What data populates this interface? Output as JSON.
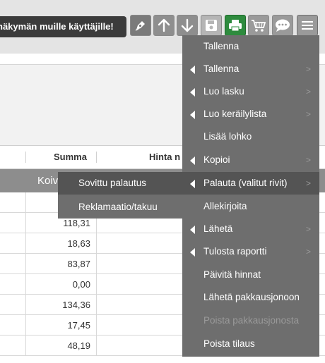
{
  "toolbar": {
    "notice": "näkymän muille käyttäjille!",
    "buttons": [
      {
        "name": "pen-icon"
      },
      {
        "name": "arrow-up-icon"
      },
      {
        "name": "arrow-down-icon"
      },
      {
        "name": "save-icon"
      },
      {
        "name": "print-icon"
      },
      {
        "name": "cart-icon"
      },
      {
        "name": "comment-icon"
      },
      {
        "name": "hamburger-menu-icon"
      }
    ]
  },
  "table": {
    "headers": [
      "Summa",
      "Hinta n"
    ],
    "group_label": "Koiv",
    "sums": [
      "",
      "118,31",
      "18,63",
      "83,87",
      "0,00",
      "134,36",
      "17,45",
      "48,19"
    ]
  },
  "menu": {
    "items": [
      {
        "label": "Tallenna",
        "caret": false,
        "sub": false,
        "disabled": false
      },
      {
        "label": "Tallenna",
        "caret": true,
        "sub": true,
        "disabled": false
      },
      {
        "label": "Luo lasku",
        "caret": true,
        "sub": true,
        "disabled": false
      },
      {
        "label": "Luo keräilylista",
        "caret": true,
        "sub": true,
        "disabled": false
      },
      {
        "label": "Lisää lohko",
        "caret": false,
        "sub": false,
        "disabled": false
      },
      {
        "label": "Kopioi",
        "caret": true,
        "sub": true,
        "disabled": false
      },
      {
        "label": "Palauta (valitut rivit)",
        "caret": true,
        "sub": true,
        "disabled": false
      },
      {
        "label": "Allekirjoita",
        "caret": false,
        "sub": false,
        "disabled": false
      },
      {
        "label": "Lähetä",
        "caret": true,
        "sub": true,
        "disabled": false
      },
      {
        "label": "Tulosta raportti",
        "caret": true,
        "sub": true,
        "disabled": false
      },
      {
        "label": "Päivitä hinnat",
        "caret": false,
        "sub": false,
        "disabled": false
      },
      {
        "label": "Lähetä pakkausjonoon",
        "caret": false,
        "sub": false,
        "disabled": false
      },
      {
        "label": "Poista pakkausjonosta",
        "caret": false,
        "sub": false,
        "disabled": true
      },
      {
        "label": "Poista tilaus",
        "caret": false,
        "sub": false,
        "disabled": false
      }
    ],
    "highlighted_index": 6
  },
  "submenu": {
    "items": [
      {
        "label": "Sovittu palautus"
      },
      {
        "label": "Reklamaatio/takuu"
      }
    ],
    "highlighted_index": 0
  },
  "colors": {
    "toolbar_bg": "#e4e4e4",
    "menu_bg": "#6e6e6e",
    "menu_highlight": "#545454",
    "print_green": "#2e8b3e",
    "button_grey": "#9a9a9a"
  }
}
